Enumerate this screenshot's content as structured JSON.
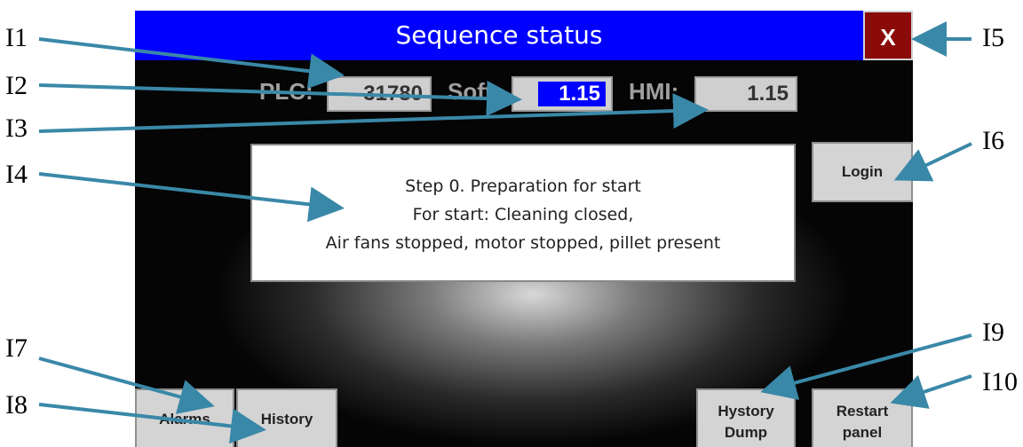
{
  "window": {
    "title": "Sequence status",
    "close_label": "X"
  },
  "versions": {
    "plc_label": "PLC:",
    "plc_value": "31780",
    "soft_label": "Soft:",
    "soft_value": "1.15",
    "hmi_label": "HMI:",
    "hmi_value": "1.15"
  },
  "step": {
    "line1": "Step 0. Preparation for start",
    "line2": "For start: Cleaning closed,",
    "line3": "Air fans stopped,  motor stopped, pillet present"
  },
  "buttons": {
    "login": "Login",
    "alarms": "Alarms",
    "history": "History",
    "hystory_dump_1": "Hystory",
    "hystory_dump_2": "Dump",
    "restart_1": "Restart",
    "restart_2": "panel"
  },
  "annotations": [
    "I1",
    "I2",
    "I3",
    "I4",
    "I5",
    "I6",
    "I7",
    "I8",
    "I9",
    "I10"
  ],
  "colors": {
    "titlebar": "#0000ff",
    "close": "#8b0a0a",
    "arrow": "#3a88a8"
  }
}
